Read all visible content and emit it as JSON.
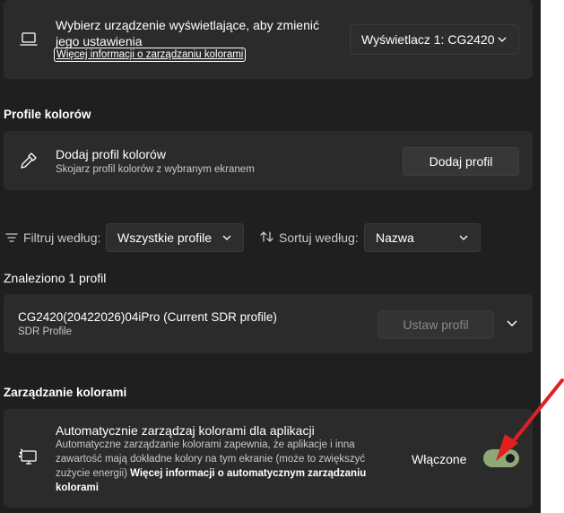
{
  "display_card": {
    "title_line1": "Wybierz urządzenie wyświetlające, aby zmienić",
    "title_line2": "jego ustawienia",
    "link": "Więcej informacji o zarządzaniu kolorami",
    "dropdown_value": "Wyświetlacz 1: CG2420",
    "icon": "laptop-icon"
  },
  "color_profiles": {
    "section_title": "Profile kolorów",
    "add_card": {
      "title": "Dodaj profil kolorów",
      "subtitle": "Skojarz profil kolorów z wybranym ekranem",
      "button": "Dodaj profil",
      "icon": "eyedropper-icon"
    },
    "filter_label": "Filtruj według:",
    "filter_value": "Wszystkie profile",
    "sort_label": "Sortuj według:",
    "sort_value": "Nazwa",
    "found_label": "Znaleziono 1 profil",
    "profile": {
      "name": "CG2420(20422026)04iPro (Current SDR profile)",
      "type": "SDR Profile",
      "button": "Ustaw profil"
    }
  },
  "color_management": {
    "section_title": "Zarządzanie kolorami",
    "title": "Automatycznie zarządzaj kolorami dla aplikacji",
    "desc_line1": "Automatyczne zarządzanie kolorami zapewnia, że aplikacje i inna",
    "desc_line2": "zawartość mają dokładne kolory na tym ekranie (może to zwiększyć",
    "desc_line3_plain": "zużycie energii)",
    "desc_link_line1": "Więcej informacji o automatycznym zarządzaniu",
    "desc_link_line2": "kolorami",
    "toggle_label": "Włączone",
    "toggle_state": true,
    "icon": "display-color-icon"
  },
  "colors": {
    "toggle_on": "#8fa878",
    "annotation_arrow": "#e02020"
  }
}
